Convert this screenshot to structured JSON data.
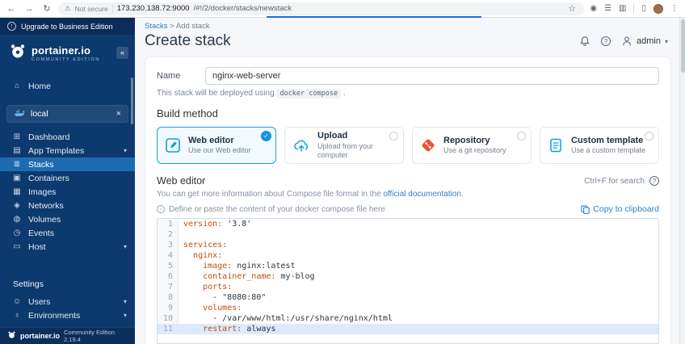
{
  "browser": {
    "security_label": "Not secure",
    "url_host": "173.230.138.72:9000",
    "url_path": "/#!/2/docker/stacks/newstack"
  },
  "sidebar": {
    "upgrade_banner": "Upgrade to Business Edition",
    "logo_title": "portainer.io",
    "logo_subtitle": "COMMUNITY EDITION",
    "collapse_icon": "«",
    "home": {
      "icon": "⌂",
      "label": "Home"
    },
    "environment": {
      "label": "local"
    },
    "items": [
      {
        "icon": "⊞",
        "label": "Dashboard"
      },
      {
        "icon": "▤",
        "label": "App Templates",
        "chevron": true
      },
      {
        "icon": "≣",
        "label": "Stacks",
        "active": true
      },
      {
        "icon": "▣",
        "label": "Containers"
      },
      {
        "icon": "▦",
        "label": "Images"
      },
      {
        "icon": "◈",
        "label": "Networks"
      },
      {
        "icon": "◍",
        "label": "Volumes"
      },
      {
        "icon": "◷",
        "label": "Events"
      },
      {
        "icon": "▭",
        "label": "Host",
        "chevron": true
      }
    ],
    "settings_label": "Settings",
    "settings_items": [
      {
        "icon": "☺",
        "label": "Users",
        "chevron": true
      },
      {
        "icon": "♁",
        "label": "Environments",
        "chevron": true
      }
    ],
    "footer_brand": "portainer.io",
    "footer_edition": "Community Edition 2.19.4"
  },
  "header": {
    "breadcrumb_link": "Stacks",
    "breadcrumb_separator": ">",
    "breadcrumb_current": "Add stack",
    "title": "Create stack",
    "user": "admin"
  },
  "form": {
    "name_label": "Name",
    "name_value": "nginx-web-server",
    "deploy_note_prefix": "This stack will be deployed using",
    "deploy_note_code": "docker compose",
    "deploy_note_suffix": ".",
    "build_method_title": "Build method",
    "methods": [
      {
        "label": "Web editor",
        "description": "Use our Web editor",
        "selected": true
      },
      {
        "label": "Upload",
        "description": "Upload from your computer",
        "selected": false
      },
      {
        "label": "Repository",
        "description": "Use a git repository",
        "selected": false
      },
      {
        "label": "Custom template",
        "description": "Use a custom template",
        "selected": false
      }
    ]
  },
  "editor": {
    "section_title": "Web editor",
    "search_hint": "Ctrl+F for search",
    "info_prefix": "You can get more information about Compose file format in the",
    "info_link": "official documentation.",
    "placeholder_hint": "Define or paste the content of your docker compose file here",
    "copy_label": "Copy to clipboard",
    "active_line": 11,
    "code_lines": [
      "version: '3.8'",
      "",
      "services:",
      "  nginx:",
      "    image: nginx:latest",
      "    container_name: my-blog",
      "    ports:",
      "      - \"8080:80\"",
      "    volumes:",
      "      - /var/www/html:/usr/share/nginx/html",
      "    restart: always"
    ]
  }
}
